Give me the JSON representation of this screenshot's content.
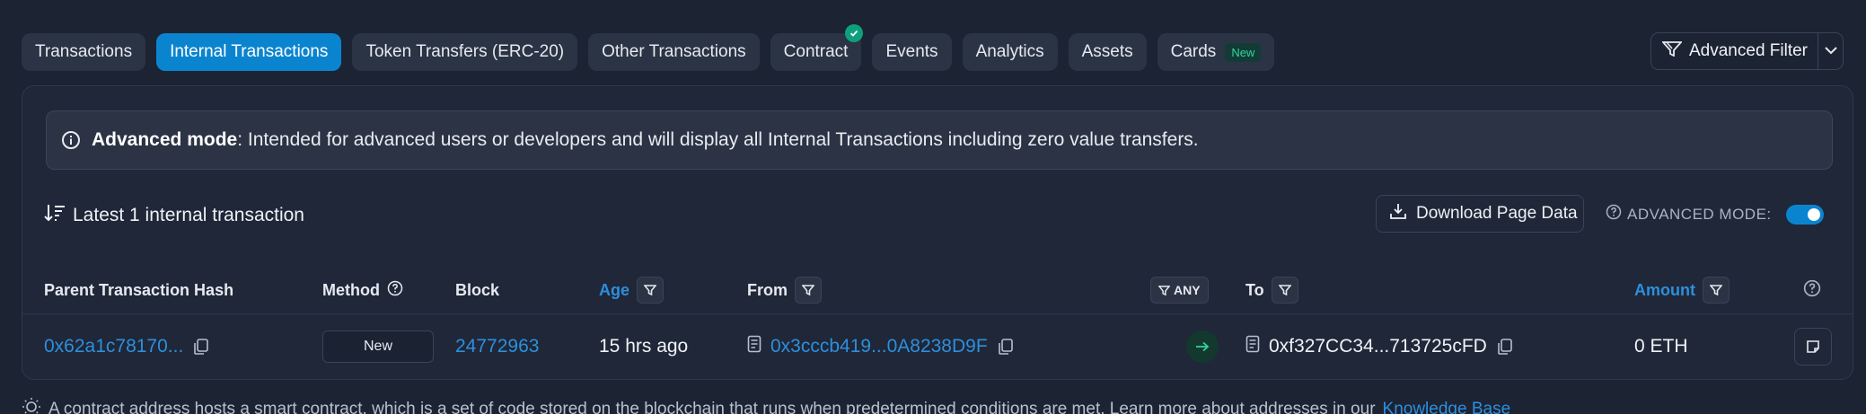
{
  "tabs": [
    {
      "label": "Transactions"
    },
    {
      "label": "Internal Transactions"
    },
    {
      "label": "Token Transfers (ERC-20)"
    },
    {
      "label": "Other Transactions"
    },
    {
      "label": "Contract"
    },
    {
      "label": "Events"
    },
    {
      "label": "Analytics"
    },
    {
      "label": "Assets"
    },
    {
      "label": "Cards",
      "badge": "New"
    }
  ],
  "advanced_filter": {
    "label": "Advanced Filter"
  },
  "alert": {
    "title": "Advanced mode",
    "text": ": Intended for advanced users or developers and will display all Internal Transactions including zero value transfers."
  },
  "summary": "Latest 1 internal transaction",
  "download_label": "Download Page Data",
  "advanced_mode_label": "ADVANCED MODE:",
  "advanced_mode_on": true,
  "table": {
    "headers": {
      "parent_hash": "Parent Transaction Hash",
      "method": "Method",
      "block": "Block",
      "age": "Age",
      "from": "From",
      "any": "ANY",
      "to": "To",
      "amount": "Amount"
    },
    "row": {
      "parent_hash": "0x62a1c78170...",
      "method": "New",
      "block": "24772963",
      "age": "15 hrs ago",
      "from": "0x3cccb419...0A8238D9F",
      "to": "0xf327CC34...713725cFD",
      "amount": "0 ETH"
    }
  },
  "footer": {
    "text": "A contract address hosts a smart contract, which is a set of code stored on the blockchain that runs when predetermined conditions are met. Learn more about addresses in our",
    "link": "Knowledge Base"
  },
  "colors": {
    "background": "#1c2333",
    "accent": "#0b84d0",
    "link": "#2d8fdd",
    "success": "#0e9f7d"
  }
}
